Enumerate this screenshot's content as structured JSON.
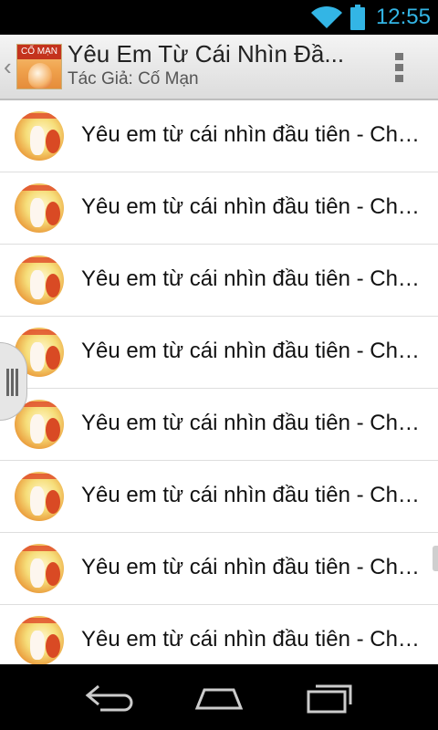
{
  "status_bar": {
    "time": "12:55",
    "icons": [
      "wifi-icon",
      "battery-icon"
    ]
  },
  "action_bar": {
    "icon_text": "CỐ MẠN",
    "title": "Yêu Em Từ Cái Nhìn Đầ...",
    "subtitle": "Tác Giả: Cố Mạn",
    "icons": [
      "up-chevron-icon",
      "book-cover-icon",
      "overflow-menu-icon"
    ]
  },
  "chapters": [
    {
      "label": "Yêu em từ cái nhìn đầu tiên - Chươ..."
    },
    {
      "label": "Yêu em từ cái nhìn đầu tiên - Chươ..."
    },
    {
      "label": "Yêu em từ cái nhìn đầu tiên - Chươ..."
    },
    {
      "label": "Yêu em từ cái nhìn đầu tiên - Chươ..."
    },
    {
      "label": "Yêu em từ cái nhìn đầu tiên - Chươ..."
    },
    {
      "label": "Yêu em từ cái nhìn đầu tiên - Chươ..."
    },
    {
      "label": "Yêu em từ cái nhìn đầu tiên - Chươ..."
    },
    {
      "label": "Yêu em từ cái nhìn đầu tiên - Chươ..."
    }
  ],
  "nav_bar": {
    "icons": [
      "back-icon",
      "home-icon",
      "recent-apps-icon"
    ]
  },
  "colors": {
    "status_accent": "#33b5e5",
    "action_bar": "#e8e8e8",
    "list_bg": "#ffffff",
    "divider": "#dedede"
  }
}
